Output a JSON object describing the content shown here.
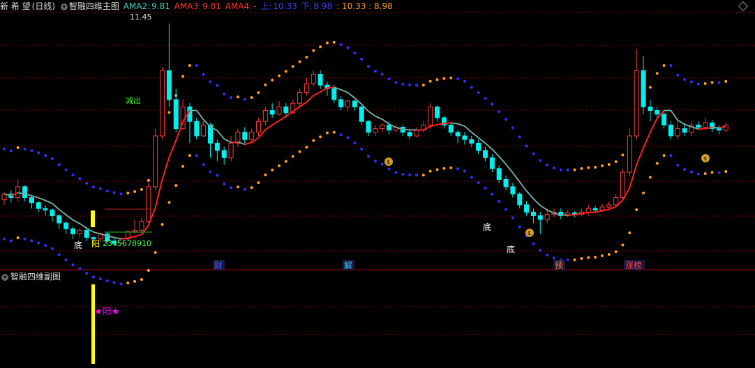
{
  "header": {
    "stock_name": "新 希 望",
    "period": "(日线)",
    "indicator_name": "智融四维主图",
    "ama2_label": "AMA2:",
    "ama2_value": "9.81",
    "ama3_label": "AMA3:",
    "ama3_value": "9.81",
    "ama4_label": "AMA4:",
    "ama4_value": "-",
    "upper_label": "上:",
    "upper_value": "10.33",
    "lower_label": "下:",
    "lower_value": "8.98",
    "extra_values": ": 10.33 : 8.98"
  },
  "sub_header": {
    "indicator_name": "智融四维副图"
  },
  "colors": {
    "up": "#ff3c3c",
    "down": "#00f0f0",
    "ma_red": "#ff2020",
    "ma_cyan": "#40d0c0",
    "band_orange": "#ffa020",
    "band_blue": "#3030ff",
    "grid": "#8b0000",
    "yellow": "#ffff00",
    "magenta": "#ff00ff",
    "green": "#40ff40"
  },
  "chart_data": {
    "type": "candlestick",
    "price_labels": {
      "high": "11.45"
    },
    "annotations": {
      "bottom_labels": [
        "底",
        "底",
        "底"
      ],
      "sun_label": "阳",
      "count_label": "2345678910",
      "sell_label": "减出",
      "event_markers": [
        "财",
        "解",
        "预",
        "涨榜"
      ],
      "money_icon_count": 3,
      "sub_signal": "★阳★"
    },
    "candles": [
      [
        9.02,
        9.1,
        8.95,
        9.12
      ],
      [
        9.1,
        9.05,
        8.98,
        9.15
      ],
      [
        9.05,
        9.2,
        9.0,
        9.3
      ],
      [
        9.2,
        9.05,
        9.0,
        9.22
      ],
      [
        9.05,
        8.98,
        8.9,
        9.08
      ],
      [
        8.98,
        8.9,
        8.85,
        9.0
      ],
      [
        8.9,
        8.88,
        8.8,
        8.95
      ],
      [
        8.88,
        8.8,
        8.72,
        8.9
      ],
      [
        8.8,
        8.7,
        8.62,
        8.82
      ],
      [
        8.7,
        8.62,
        8.55,
        8.72
      ],
      [
        8.62,
        8.55,
        8.48,
        8.65
      ],
      [
        8.55,
        8.6,
        8.5,
        8.62
      ],
      [
        8.6,
        8.5,
        8.45,
        8.64
      ],
      [
        8.5,
        8.48,
        8.4,
        8.52
      ],
      [
        8.48,
        8.55,
        8.44,
        8.58
      ],
      [
        8.55,
        8.45,
        8.4,
        8.58
      ],
      [
        8.45,
        8.42,
        8.38,
        8.5
      ],
      [
        8.42,
        8.48,
        8.4,
        8.5
      ],
      [
        8.48,
        8.58,
        8.45,
        8.6
      ],
      [
        8.58,
        8.6,
        8.55,
        8.75
      ],
      [
        8.6,
        8.72,
        8.58,
        8.78
      ],
      [
        8.72,
        9.2,
        8.7,
        9.25
      ],
      [
        9.2,
        9.9,
        9.15,
        10.0
      ],
      [
        9.9,
        10.8,
        9.85,
        10.85
      ],
      [
        10.8,
        10.4,
        10.3,
        11.45
      ],
      [
        10.4,
        10.0,
        9.95,
        10.55
      ],
      [
        10.0,
        10.3,
        9.98,
        10.4
      ],
      [
        10.3,
        10.1,
        9.8,
        10.35
      ],
      [
        10.1,
        9.9,
        9.85,
        10.15
      ],
      [
        9.9,
        10.05,
        9.88,
        10.1
      ],
      [
        10.05,
        9.8,
        9.6,
        10.08
      ],
      [
        9.8,
        9.7,
        9.55,
        9.85
      ],
      [
        9.7,
        9.6,
        9.5,
        9.75
      ],
      [
        9.6,
        9.8,
        9.55,
        9.9
      ],
      [
        9.8,
        9.95,
        9.75,
        10.0
      ],
      [
        9.95,
        9.85,
        9.8,
        10.02
      ],
      [
        9.85,
        9.95,
        9.82,
        10.0
      ],
      [
        9.95,
        10.1,
        9.9,
        10.15
      ],
      [
        10.1,
        10.25,
        10.05,
        10.3
      ],
      [
        10.25,
        10.2,
        10.15,
        10.35
      ],
      [
        10.2,
        10.3,
        10.18,
        10.38
      ],
      [
        10.3,
        10.22,
        10.15,
        10.35
      ],
      [
        10.22,
        10.35,
        10.2,
        10.4
      ],
      [
        10.35,
        10.5,
        10.3,
        10.55
      ],
      [
        10.5,
        10.62,
        10.45,
        10.7
      ],
      [
        10.62,
        10.75,
        10.58,
        10.8
      ],
      [
        10.75,
        10.6,
        10.55,
        10.8
      ],
      [
        10.6,
        10.55,
        10.45,
        10.65
      ],
      [
        10.55,
        10.4,
        10.35,
        10.6
      ],
      [
        10.4,
        10.3,
        10.25,
        10.45
      ],
      [
        10.3,
        10.38,
        10.25,
        10.4
      ],
      [
        10.38,
        10.3,
        10.25,
        10.4
      ],
      [
        10.3,
        10.1,
        10.05,
        10.32
      ],
      [
        10.1,
        9.95,
        9.9,
        10.12
      ],
      [
        9.95,
        10.0,
        9.9,
        10.05
      ],
      [
        10.0,
        10.05,
        9.95,
        10.08
      ],
      [
        10.05,
        9.98,
        9.92,
        10.1
      ],
      [
        9.98,
        10.02,
        9.95,
        10.06
      ],
      [
        10.02,
        9.95,
        9.9,
        10.05
      ],
      [
        9.95,
        9.9,
        9.85,
        10.0
      ],
      [
        9.9,
        9.98,
        9.88,
        10.02
      ],
      [
        9.98,
        10.05,
        9.95,
        10.1
      ],
      [
        10.05,
        10.3,
        10.0,
        10.35
      ],
      [
        10.3,
        10.15,
        10.1,
        10.32
      ],
      [
        10.15,
        10.05,
        10.0,
        10.18
      ],
      [
        10.05,
        9.95,
        9.9,
        10.08
      ],
      [
        9.95,
        9.9,
        9.8,
        9.98
      ],
      [
        9.9,
        9.85,
        9.78,
        9.95
      ],
      [
        9.85,
        9.8,
        9.75,
        9.9
      ],
      [
        9.8,
        9.7,
        9.65,
        9.85
      ],
      [
        9.7,
        9.6,
        9.55,
        9.75
      ],
      [
        9.6,
        9.45,
        9.4,
        9.65
      ],
      [
        9.45,
        9.3,
        9.25,
        9.5
      ],
      [
        9.3,
        9.2,
        9.15,
        9.35
      ],
      [
        9.2,
        9.1,
        9.05,
        9.25
      ],
      [
        9.1,
        8.95,
        8.9,
        9.12
      ],
      [
        8.95,
        8.85,
        8.8,
        9.0
      ],
      [
        8.85,
        8.8,
        8.7,
        8.9
      ],
      [
        8.8,
        8.75,
        8.55,
        8.85
      ],
      [
        8.75,
        8.82,
        8.7,
        8.9
      ],
      [
        8.82,
        8.85,
        8.78,
        8.9
      ],
      [
        8.85,
        8.8,
        8.75,
        8.9
      ],
      [
        8.8,
        8.84,
        8.78,
        8.88
      ],
      [
        8.84,
        8.82,
        8.78,
        8.86
      ],
      [
        8.82,
        8.85,
        8.8,
        8.9
      ],
      [
        8.85,
        8.9,
        8.8,
        8.95
      ],
      [
        8.9,
        8.88,
        8.84,
        8.94
      ],
      [
        8.88,
        8.92,
        8.85,
        8.96
      ],
      [
        8.92,
        8.95,
        8.88,
        9.0
      ],
      [
        8.95,
        9.05,
        8.92,
        9.1
      ],
      [
        9.05,
        9.4,
        9.0,
        9.45
      ],
      [
        9.4,
        9.9,
        9.35,
        10.0
      ],
      [
        9.9,
        10.8,
        9.85,
        11.1
      ],
      [
        10.8,
        10.3,
        10.2,
        11.0
      ],
      [
        10.3,
        10.25,
        10.1,
        10.4
      ],
      [
        10.25,
        10.2,
        10.15,
        10.3
      ],
      [
        10.2,
        10.05,
        10.0,
        10.25
      ],
      [
        10.05,
        9.9,
        9.85,
        10.1
      ],
      [
        9.9,
        10.0,
        9.85,
        10.1
      ],
      [
        10.0,
        9.95,
        9.9,
        10.08
      ],
      [
        9.95,
        10.05,
        9.9,
        10.1
      ],
      [
        10.05,
        10.02,
        9.98,
        10.1
      ],
      [
        10.02,
        10.08,
        10.0,
        10.15
      ],
      [
        10.08,
        10.0,
        9.95,
        10.12
      ],
      [
        10.0,
        9.98,
        9.92,
        10.05
      ],
      [
        9.98,
        10.05,
        9.95,
        10.08
      ]
    ]
  }
}
